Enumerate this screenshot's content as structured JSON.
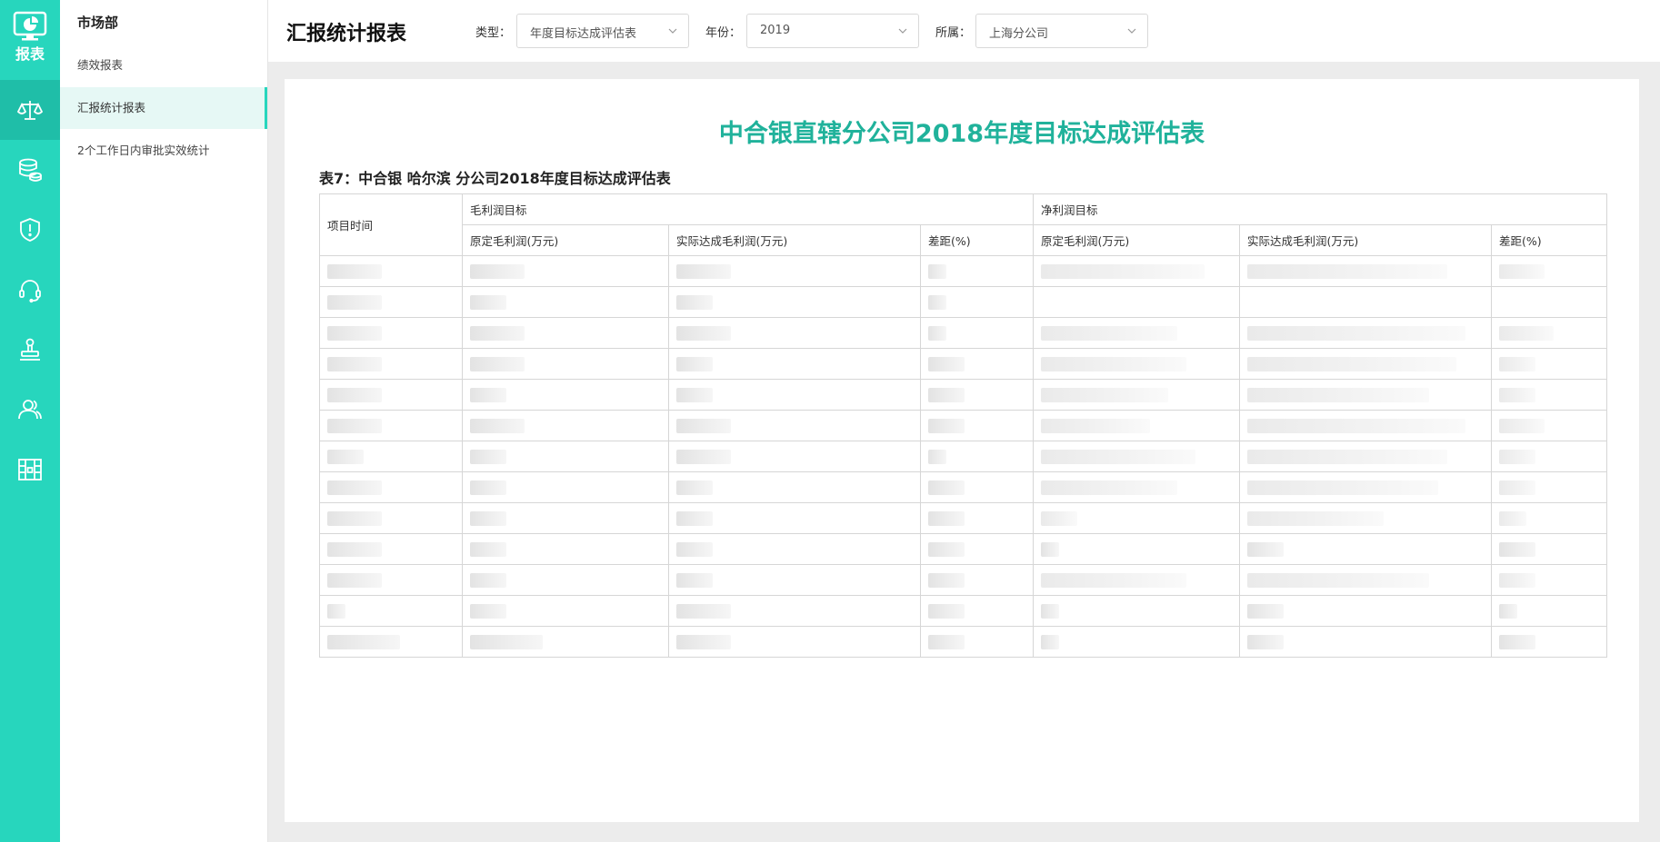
{
  "rail": {
    "logo_label": "报表",
    "items": [
      {
        "icon": "scale-icon",
        "active": true
      },
      {
        "icon": "coins-icon",
        "active": false
      },
      {
        "icon": "shield-alert-icon",
        "active": false
      },
      {
        "icon": "headset-icon",
        "active": false
      },
      {
        "icon": "stamp-icon",
        "active": false
      },
      {
        "icon": "users-icon",
        "active": false
      },
      {
        "icon": "archive-icon",
        "active": false
      }
    ]
  },
  "submenu": {
    "department": "市场部",
    "items": [
      {
        "label": "绩效报表"
      },
      {
        "label": "汇报统计报表"
      },
      {
        "label": "2个工作日内审批实效统计"
      }
    ]
  },
  "header": {
    "title": "汇报统计报表",
    "filters": {
      "type_label": "类型：",
      "type_value": "年度目标达成评估表",
      "year_label": "年份：",
      "year_value": "2019",
      "branch_label": "所属：",
      "branch_value": "上海分公司"
    }
  },
  "report": {
    "title": "中合银直辖分公司2018年度目标达成评估表",
    "caption": "表7：中合银 哈尔滨 分公司2018年度目标达成评估表",
    "headers": {
      "item_time": "项目时间",
      "gross_group": "毛利润目标",
      "net_group": "净利润目标",
      "gross_cols": [
        "原定毛利润(万元)",
        "实际达成毛利润(万元)",
        "差距(%)"
      ],
      "net_cols": [
        "原定毛利润(万元)",
        "实际达成毛利润(万元)",
        "差距(%)"
      ]
    }
  },
  "colors": {
    "accent": "#27d6bd",
    "title_green": "#20b29b"
  }
}
